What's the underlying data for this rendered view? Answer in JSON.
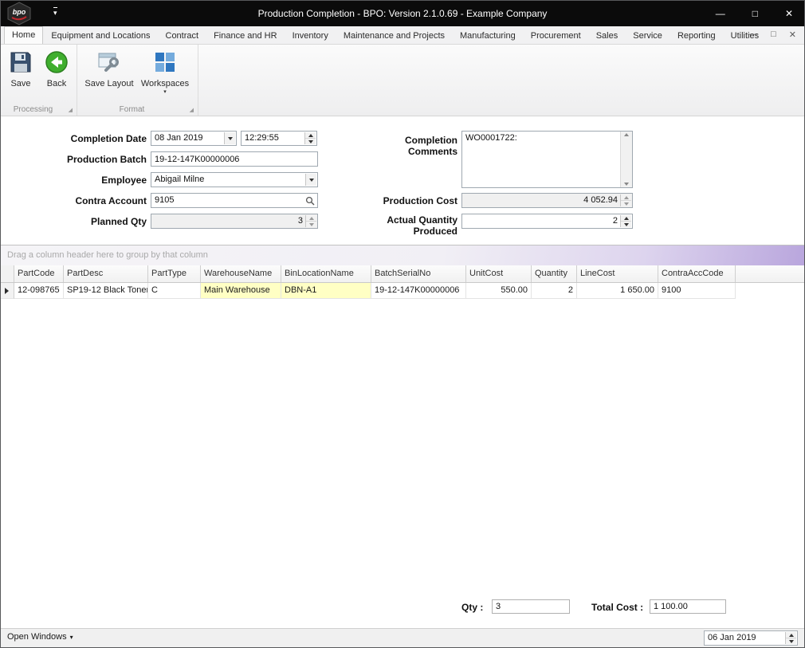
{
  "window": {
    "logo": "bpo",
    "title": "Production Completion - BPO: Version 2.1.0.69 - Example Company",
    "controls": {
      "minimize": "—",
      "maximize": "□",
      "close": "✕"
    }
  },
  "icons": {
    "qat_dropdown": "▾",
    "workspaces_dropdown": "▾",
    "open_windows_dropdown": "▾",
    "dialog_launcher": "◢"
  },
  "ribbon": {
    "tabs": [
      "Home",
      "Equipment and Locations",
      "Contract",
      "Finance and HR",
      "Inventory",
      "Maintenance and Projects",
      "Manufacturing",
      "Procurement",
      "Sales",
      "Service",
      "Reporting",
      "Utilities"
    ],
    "mdi": {
      "minimize": "—",
      "restore": "□",
      "close": "✕"
    },
    "buttons": {
      "save": "Save",
      "back": "Back",
      "save_layout": "Save Layout",
      "workspaces": "Workspaces"
    },
    "groups": {
      "processing": "Processing",
      "format": "Format"
    }
  },
  "form": {
    "completion_date": {
      "label": "Completion Date",
      "date": "08 Jan 2019",
      "time": "12:29:55"
    },
    "production_batch": {
      "label": "Production Batch",
      "value": "19-12-147K00000006"
    },
    "employee": {
      "label": "Employee",
      "value": "Abigail Milne"
    },
    "contra_account": {
      "label": "Contra Account",
      "value": "9105"
    },
    "planned_qty": {
      "label": "Planned Qty",
      "value": "3"
    },
    "completion_comments": {
      "label": "Completion Comments",
      "value": "WO0001722:"
    },
    "production_cost": {
      "label": "Production Cost",
      "value": "4 052.94"
    },
    "actual_quantity": {
      "label": "Actual Quantity Produced",
      "value": "2"
    }
  },
  "grid": {
    "group_hint": "Drag a column header here to group by that column",
    "columns": [
      "PartCode",
      "PartDesc",
      "PartType",
      "WarehouseName",
      "BinLocationName",
      "BatchSerialNo",
      "UnitCost",
      "Quantity",
      "LineCost",
      "ContraAccCode"
    ],
    "rows": [
      [
        "12-098765",
        "SP19-12 Black Toner",
        "C",
        "Main Warehouse",
        "DBN-A1",
        "19-12-147K00000006",
        "550.00",
        "2",
        "1 650.00",
        "9100"
      ]
    ]
  },
  "footer": {
    "qty_label": "Qty :",
    "qty_value": "3",
    "total_cost_label": "Total Cost :",
    "total_cost_value": "1 100.00"
  },
  "statusbar": {
    "open_windows": "Open Windows",
    "date": "06 Jan 2019"
  }
}
